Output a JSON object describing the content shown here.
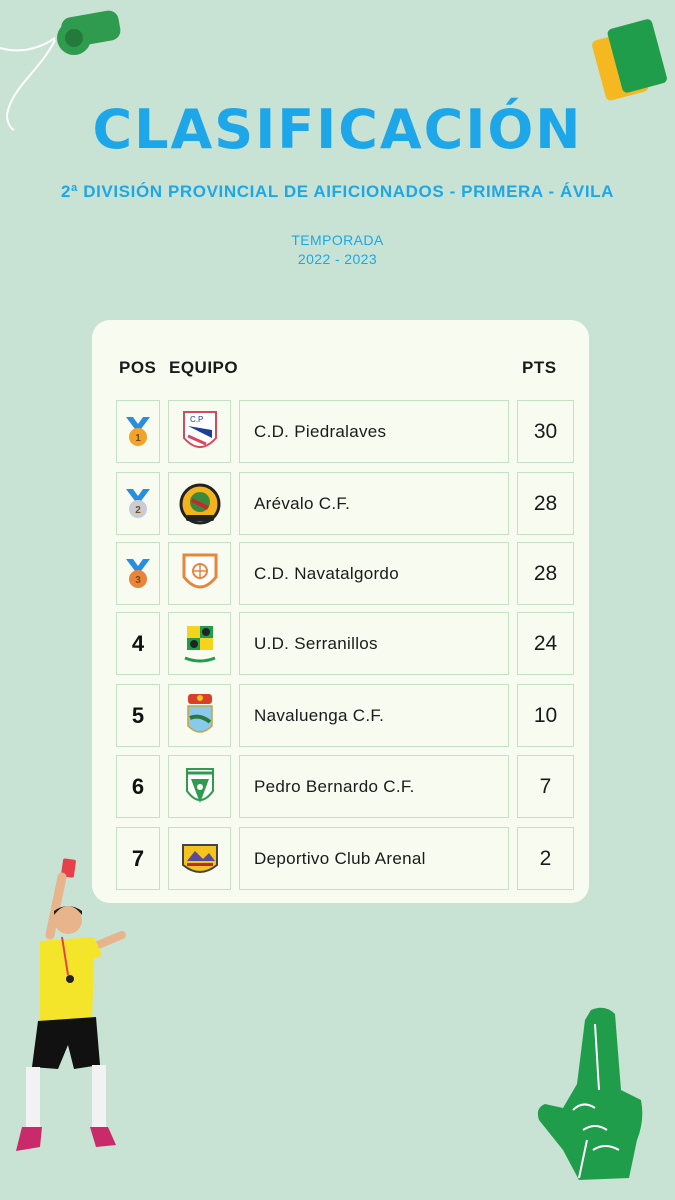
{
  "title": "CLASIFICACIÓN",
  "subtitle": "2ª DIVISIÓN PROVINCIAL DE AIFICIONADOS - PRIMERA - ÁVILA",
  "season_label": "TEMPORADA",
  "season_years": "2022 - 2023",
  "table": {
    "headers": {
      "pos": "POS",
      "team": "EQUIPO",
      "pts": "PTS"
    },
    "rows": [
      {
        "pos": "1",
        "medal": "gold",
        "team": "C.D. Piedralaves",
        "pts": "30",
        "logo_icon": "piedralaves-crest-icon"
      },
      {
        "pos": "2",
        "medal": "silver",
        "team": "Arévalo C.F.",
        "pts": "28",
        "logo_icon": "arevalo-crest-icon"
      },
      {
        "pos": "3",
        "medal": "bronze",
        "team": "C.D. Navatalgordo",
        "pts": "28",
        "logo_icon": "navatalgordo-crest-icon"
      },
      {
        "pos": "4",
        "team": "U.D. Serranillos",
        "pts": "24",
        "logo_icon": "serranillos-crest-icon"
      },
      {
        "pos": "5",
        "team": "Navaluenga C.F.",
        "pts": "10",
        "logo_icon": "navaluenga-crest-icon"
      },
      {
        "pos": "6",
        "team": "Pedro Bernardo C.F.",
        "pts": "7",
        "logo_icon": "pedro-bernardo-crest-icon"
      },
      {
        "pos": "7",
        "team": "Deportivo Club Arenal",
        "pts": "2",
        "logo_icon": "arenal-crest-icon"
      }
    ]
  },
  "colors": {
    "background": "#c8e2d4",
    "accent": "#1ea7e8",
    "card": "#f8fcf0",
    "cell_border": "#c6e0c4",
    "gold": "#f2a32a",
    "silver": "#c9ccd3",
    "bronze": "#e8853a"
  },
  "decorations": [
    "whistle-icon",
    "referee-cards-icon",
    "referee-illustration",
    "foam-finger-icon"
  ]
}
